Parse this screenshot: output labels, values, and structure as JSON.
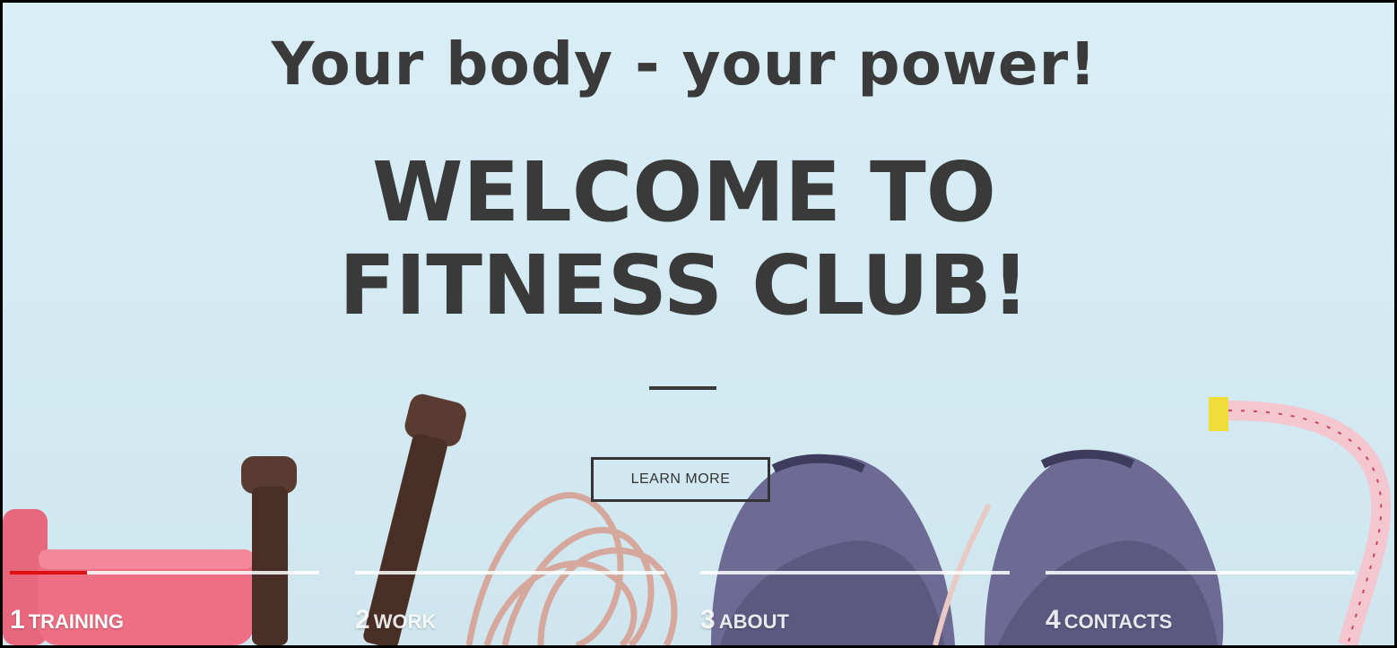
{
  "hero": {
    "tagline": "Your body - your power!",
    "title_line1": "WELCOME TO",
    "title_line2": "FITNESS CLUB!",
    "button_label": "LEARN MORE"
  },
  "nav": {
    "items": [
      {
        "number": "1",
        "label": "TRAINING",
        "active": true,
        "progress": 0.25
      },
      {
        "number": "2",
        "label": "WORK",
        "active": false,
        "progress": 0
      },
      {
        "number": "3",
        "label": "ABOUT",
        "active": false,
        "progress": 0
      },
      {
        "number": "4",
        "label": "CONTACTS",
        "active": false,
        "progress": 0
      }
    ]
  },
  "colors": {
    "background": "#d9eef5",
    "text": "#3a3a3a",
    "accent": "#e01010",
    "nav_text": "#ffffff"
  },
  "scene": {
    "objects": [
      "dumbbell",
      "jump-rope",
      "sneakers",
      "measuring-tape"
    ]
  }
}
